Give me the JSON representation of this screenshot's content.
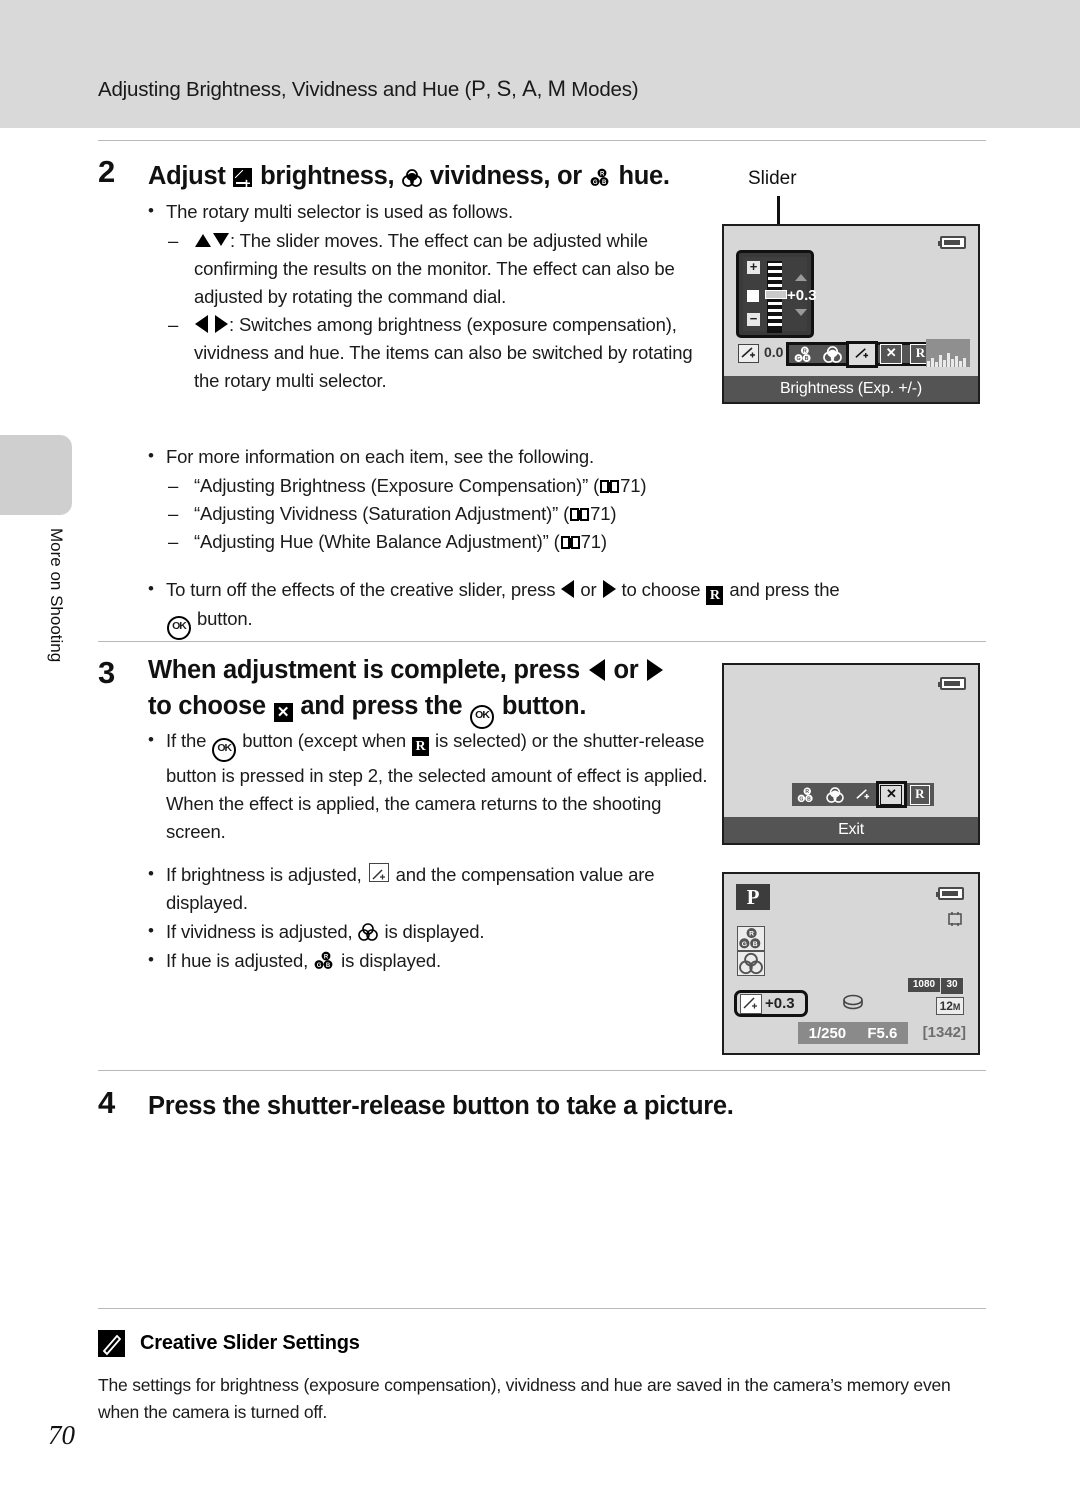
{
  "header": {
    "title_prefix": "Adjusting Brightness, Vividness and Hue (",
    "modes": [
      "P",
      "S",
      "A",
      "M"
    ],
    "title_suffix": " Modes)"
  },
  "sidebar": {
    "tab_label": "More on Shooting"
  },
  "page_number": "70",
  "steps": [
    {
      "number": "2",
      "heading_a": "Adjust",
      "heading_b": "brightness,",
      "heading_c": "vividness, or",
      "heading_d": "hue.",
      "bullets": [
        "The rotary multi selector is used as follows.",
        ": The slider moves. The effect can be adjusted while confirming the results on the monitor. The effect can also be adjusted by rotating the command dial.",
        ": Switches among brightness (exposure compensation), vividness and hue. The items can also be switched by rotating the rotary multi selector.",
        "For more information on each item, see the following.",
        "“Adjusting Brightness (Exposure Compensation)” (",
        "“Adjusting Vividness (Saturation Adjustment)” (",
        "“Adjusting Hue (White Balance Adjustment)” (",
        "To turn off the effects of the creative slider, press",
        "or",
        "to choose",
        "and press the",
        "button."
      ],
      "page_ref": "71"
    },
    {
      "number": "3",
      "heading_line1_a": "When adjustment is complete, press",
      "heading_line1_or": "or",
      "heading_line2_a": "to choose",
      "heading_line2_b": "and press the",
      "heading_line2_c": "button.",
      "bullets": [
        "If the",
        "button (except when",
        "is selected) or the shutter-release button is pressed in step 2, the selected amount of effect is applied. When the effect is applied, the camera returns to the shooting screen.",
        "If brightness is adjusted,",
        "and the compensation value are displayed.",
        "If vividness is adjusted,",
        "is displayed.",
        "If hue is adjusted,",
        "is displayed."
      ]
    },
    {
      "number": "4",
      "heading": "Press the shutter-release button to take a picture."
    }
  ],
  "screens": {
    "slider_screen": {
      "callout": "Slider",
      "ev_indicator": "0.0",
      "slider_value": "+0.3",
      "plus_symbol": "+",
      "minus_symbol": "−",
      "caption": "Brightness (Exp. +/-)",
      "icons": [
        "hue-icon",
        "vividness-icon",
        "exposure-icon",
        "exit-icon",
        "reset-icon"
      ],
      "selected_icon": "exposure-icon",
      "reset_letter": "R",
      "exit_letter": "✕"
    },
    "exit_screen": {
      "caption": "Exit",
      "icons": [
        "hue-icon",
        "vividness-icon",
        "exposure-icon",
        "exit-icon",
        "reset-icon"
      ],
      "selected_icon": "exit-icon",
      "reset_letter": "R",
      "exit_letter": "✕"
    },
    "shooting_screen": {
      "mode": "P",
      "exposure_value": "+0.3",
      "shutter_speed": "1/250",
      "aperture": "F5.6",
      "shots_remaining": "[1342]",
      "movie_size": "1080",
      "movie_fps": "30",
      "image_size": "12",
      "image_size_unit": "M"
    }
  },
  "note": {
    "title": "Creative Slider Settings",
    "body": "The settings for brightness (exposure compensation), vividness and hue are saved in the camera’s memory even when the camera is turned off."
  }
}
